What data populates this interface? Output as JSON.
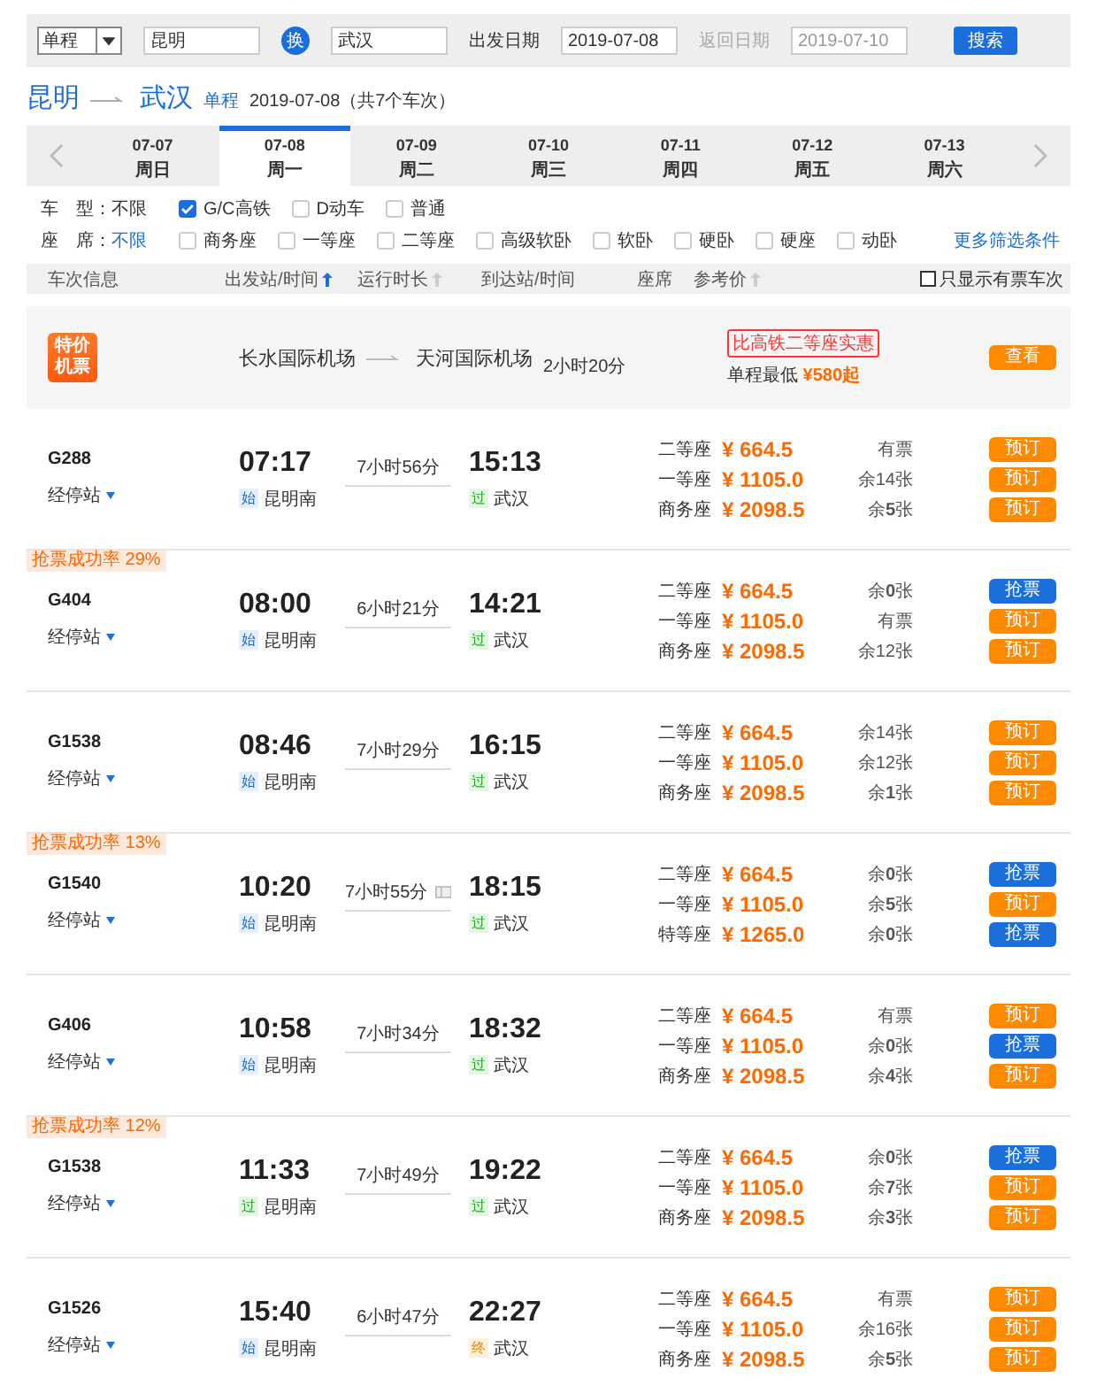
{
  "search": {
    "trip_type": "单程",
    "from": "昆明",
    "swap": "换",
    "to": "武汉",
    "depart_label": "出发日期",
    "depart_date": "2019-07-08",
    "return_label": "返回日期",
    "return_date": "2019-07-10",
    "return_disabled": true,
    "button": "搜索"
  },
  "route": {
    "from": "昆明",
    "to": "武汉",
    "trip_tag": "单程",
    "summary": "2019-07-08（共7个车次）"
  },
  "dates": [
    {
      "date": "07-07",
      "weekday": "周日",
      "selected": false
    },
    {
      "date": "07-08",
      "weekday": "周一",
      "selected": true
    },
    {
      "date": "07-09",
      "weekday": "周二",
      "selected": false
    },
    {
      "date": "07-10",
      "weekday": "周三",
      "selected": false
    },
    {
      "date": "07-11",
      "weekday": "周四",
      "selected": false
    },
    {
      "date": "07-12",
      "weekday": "周五",
      "selected": false
    },
    {
      "date": "07-13",
      "weekday": "周六",
      "selected": false
    }
  ],
  "filters": [
    {
      "label": "车　型：",
      "options": [
        {
          "kind": "text",
          "label": "不限",
          "selected": false
        },
        {
          "kind": "checkbox",
          "label": "G/C高铁",
          "checked": true
        },
        {
          "kind": "checkbox",
          "label": "D动车",
          "checked": false
        },
        {
          "kind": "checkbox",
          "label": "普通",
          "checked": false
        }
      ]
    },
    {
      "label": "座　席：",
      "options": [
        {
          "kind": "text",
          "label": "不限",
          "selected": true
        },
        {
          "kind": "checkbox",
          "label": "商务座",
          "checked": false
        },
        {
          "kind": "checkbox",
          "label": "一等座",
          "checked": false
        },
        {
          "kind": "checkbox",
          "label": "二等座",
          "checked": false
        },
        {
          "kind": "checkbox",
          "label": "高级软卧",
          "checked": false
        },
        {
          "kind": "checkbox",
          "label": "软卧",
          "checked": false
        },
        {
          "kind": "checkbox",
          "label": "硬卧",
          "checked": false
        },
        {
          "kind": "checkbox",
          "label": "硬座",
          "checked": false
        },
        {
          "kind": "checkbox",
          "label": "动卧",
          "checked": false
        }
      ]
    }
  ],
  "more_filters": "更多筛选条件",
  "columns": [
    {
      "label": "车次信息",
      "sortable": false
    },
    {
      "label": "出发站/时间",
      "sortable": true,
      "sorted": true
    },
    {
      "label": "运行时长",
      "sortable": true,
      "sorted": false
    },
    {
      "label": "到达站/时间",
      "sortable": false
    },
    {
      "label": "座席",
      "sortable": false
    },
    {
      "label": "参考价",
      "sortable": true,
      "sorted": false
    }
  ],
  "only_available": {
    "label": "只显示有票车次",
    "checked": false
  },
  "flight_promo": {
    "badge_top": "特价",
    "badge_bottom": "机票",
    "from_airport": "长水国际机场",
    "to_airport": "天河国际机场",
    "duration": "2小时20分",
    "tag": "比高铁二等座实惠",
    "price_label": "单程最低",
    "price": "¥580起",
    "button": "查看"
  },
  "trains": [
    {
      "number": "G288",
      "stops": "经停站",
      "depart_time": "07:17",
      "depart_tag": {
        "kind": "start",
        "text": "始"
      },
      "depart_station": "昆明南",
      "duration": "7小时56分",
      "note_icon": false,
      "arrive_time": "15:13",
      "arrive_tag": {
        "kind": "pass",
        "text": "过"
      },
      "arrive_station": "武汉",
      "seats": [
        {
          "name": "二等座",
          "price": "¥ 664.5",
          "availability": "有票",
          "button": {
            "kind": "book",
            "label": "预订"
          }
        },
        {
          "name": "一等座",
          "price": "¥ 1105.0",
          "availability": "余14张",
          "button": {
            "kind": "book",
            "label": "预订"
          }
        },
        {
          "name": "商务座",
          "price": "¥ 2098.5",
          "availability": "余**5**张",
          "button": {
            "kind": "book",
            "label": "预订"
          }
        }
      ]
    },
    {
      "success_rate": "抢票成功率 29%",
      "number": "G404",
      "stops": "经停站",
      "depart_time": "08:00",
      "depart_tag": {
        "kind": "start",
        "text": "始"
      },
      "depart_station": "昆明南",
      "duration": "6小时21分",
      "note_icon": false,
      "arrive_time": "14:21",
      "arrive_tag": {
        "kind": "pass",
        "text": "过"
      },
      "arrive_station": "武汉",
      "seats": [
        {
          "name": "二等座",
          "price": "¥ 664.5",
          "availability": "余**0**张",
          "button": {
            "kind": "grab",
            "label": "抢票"
          }
        },
        {
          "name": "一等座",
          "price": "¥ 1105.0",
          "availability": "有票",
          "button": {
            "kind": "book",
            "label": "预订"
          }
        },
        {
          "name": "商务座",
          "price": "¥ 2098.5",
          "availability": "余12张",
          "button": {
            "kind": "book",
            "label": "预订"
          }
        }
      ]
    },
    {
      "number": "G1538",
      "stops": "经停站",
      "depart_time": "08:46",
      "depart_tag": {
        "kind": "start",
        "text": "始"
      },
      "depart_station": "昆明南",
      "duration": "7小时29分",
      "note_icon": false,
      "arrive_time": "16:15",
      "arrive_tag": {
        "kind": "pass",
        "text": "过"
      },
      "arrive_station": "武汉",
      "seats": [
        {
          "name": "二等座",
          "price": "¥ 664.5",
          "availability": "余14张",
          "button": {
            "kind": "book",
            "label": "预订"
          }
        },
        {
          "name": "一等座",
          "price": "¥ 1105.0",
          "availability": "余12张",
          "button": {
            "kind": "book",
            "label": "预订"
          }
        },
        {
          "name": "商务座",
          "price": "¥ 2098.5",
          "availability": "余**1**张",
          "button": {
            "kind": "book",
            "label": "预订"
          }
        }
      ]
    },
    {
      "success_rate": "抢票成功率 13%",
      "number": "G1540",
      "stops": "经停站",
      "depart_time": "10:20",
      "depart_tag": {
        "kind": "start",
        "text": "始"
      },
      "depart_station": "昆明南",
      "duration": "7小时55分",
      "note_icon": true,
      "arrive_time": "18:15",
      "arrive_tag": {
        "kind": "pass",
        "text": "过"
      },
      "arrive_station": "武汉",
      "seats": [
        {
          "name": "二等座",
          "price": "¥ 664.5",
          "availability": "余**0**张",
          "button": {
            "kind": "grab",
            "label": "抢票"
          }
        },
        {
          "name": "一等座",
          "price": "¥ 1105.0",
          "availability": "余**5**张",
          "button": {
            "kind": "book",
            "label": "预订"
          }
        },
        {
          "name": "特等座",
          "price": "¥ 1265.0",
          "availability": "余**0**张",
          "button": {
            "kind": "grab",
            "label": "抢票"
          }
        }
      ]
    },
    {
      "number": "G406",
      "stops": "经停站",
      "depart_time": "10:58",
      "depart_tag": {
        "kind": "start",
        "text": "始"
      },
      "depart_station": "昆明南",
      "duration": "7小时34分",
      "note_icon": false,
      "arrive_time": "18:32",
      "arrive_tag": {
        "kind": "pass",
        "text": "过"
      },
      "arrive_station": "武汉",
      "seats": [
        {
          "name": "二等座",
          "price": "¥ 664.5",
          "availability": "有票",
          "button": {
            "kind": "book",
            "label": "预订"
          }
        },
        {
          "name": "一等座",
          "price": "¥ 1105.0",
          "availability": "余**0**张",
          "button": {
            "kind": "grab",
            "label": "抢票"
          }
        },
        {
          "name": "商务座",
          "price": "¥ 2098.5",
          "availability": "余**4**张",
          "button": {
            "kind": "book",
            "label": "预订"
          }
        }
      ]
    },
    {
      "success_rate": "抢票成功率 12%",
      "number": "G1538",
      "stops": "经停站",
      "depart_time": "11:33",
      "depart_tag": {
        "kind": "pass",
        "text": "过"
      },
      "depart_station": "昆明南",
      "duration": "7小时49分",
      "note_icon": false,
      "arrive_time": "19:22",
      "arrive_tag": {
        "kind": "pass",
        "text": "过"
      },
      "arrive_station": "武汉",
      "seats": [
        {
          "name": "二等座",
          "price": "¥ 664.5",
          "availability": "余**0**张",
          "button": {
            "kind": "grab",
            "label": "抢票"
          }
        },
        {
          "name": "一等座",
          "price": "¥ 1105.0",
          "availability": "余**7**张",
          "button": {
            "kind": "book",
            "label": "预订"
          }
        },
        {
          "name": "商务座",
          "price": "¥ 2098.5",
          "availability": "余**3**张",
          "button": {
            "kind": "book",
            "label": "预订"
          }
        }
      ]
    },
    {
      "number": "G1526",
      "stops": "经停站",
      "depart_time": "15:40",
      "depart_tag": {
        "kind": "start",
        "text": "始"
      },
      "depart_station": "昆明南",
      "duration": "6小时47分",
      "note_icon": false,
      "arrive_time": "22:27",
      "arrive_tag": {
        "kind": "end",
        "text": "终"
      },
      "arrive_station": "武汉",
      "seats": [
        {
          "name": "二等座",
          "price": "¥ 664.5",
          "availability": "有票",
          "button": {
            "kind": "book",
            "label": "预订"
          }
        },
        {
          "name": "一等座",
          "price": "¥ 1105.0",
          "availability": "余16张",
          "button": {
            "kind": "book",
            "label": "预订"
          }
        },
        {
          "name": "商务座",
          "price": "¥ 2098.5",
          "availability": "余**5**张",
          "button": {
            "kind": "book",
            "label": "预订"
          }
        }
      ]
    }
  ]
}
